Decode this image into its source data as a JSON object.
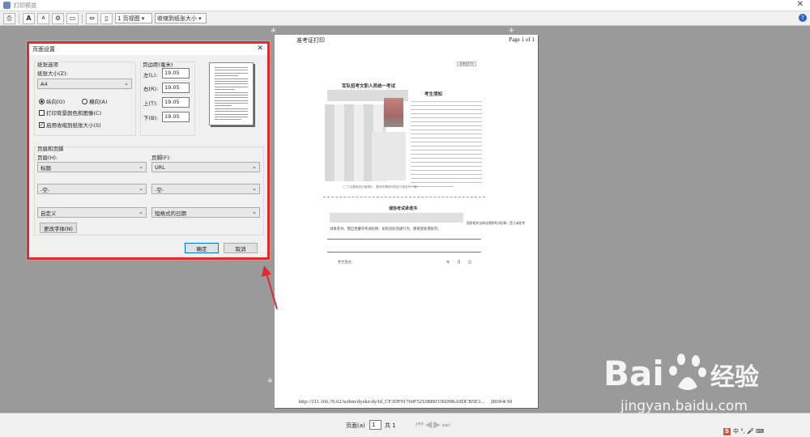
{
  "window": {
    "title": "打印预览"
  },
  "toolbar": {
    "view_select": "1 页视图",
    "shrink_select": "收缩到纸张大小",
    "text_size_a_large": "A",
    "text_size_a_small": "A"
  },
  "page_preview": {
    "header_left": "准考证打印",
    "header_right": "Page 1 of 1",
    "footer_url": "http://211.166.76.62/wzbm/dyzkz/dy/id_CF3DF91760F5210BB0336D9BA9DCB5E3...",
    "footer_date": "2019/4/10",
    "doc_title_left": "军队招考文职人员统一考试",
    "doc_title_right": "考生须知",
    "small_button": "准考证打印",
    "doc_subtitle": "诚信考试承诺书",
    "doc_line1": "试承诺书。我自觉遵守考试纪律，如有违纪违规行为，愿接受处理处罚。",
    "doc_line_right": "国家相关法律法规和考试纪律，签订诚信考",
    "photo_caption": "（二寸近期免冠正面照片，要求须清晰可辨且与报名时一致）",
    "signature_label": "考生签名：",
    "signature_icons": "年 月 日"
  },
  "dialog": {
    "title": "页面设置",
    "paper_group": "纸张选项",
    "paper_size_label": "纸张大小(Z):",
    "paper_size_value": "A4",
    "portrait_label": "纵向(O)",
    "landscape_label": "横向(A)",
    "print_bg_label": "打印背景颜色和图像(C)",
    "shrink_label": "启用收缩到纸张大小(S)",
    "margins_group": "页边距(毫米)",
    "left_label": "左(L):",
    "right_label": "右(R):",
    "top_label": "上(T):",
    "bottom_label": "下(B):",
    "left_value": "19.05",
    "right_value": "19.05",
    "top_value": "19.05",
    "bottom_value": "19.05",
    "hf_group": "页眉和页脚",
    "header_label": "页眉(H):",
    "footer_label": "页脚(F):",
    "header_1": "标题",
    "footer_1": "URL",
    "header_2": "-空-",
    "footer_2": "-空-",
    "header_3": "自定义",
    "footer_3": "短格式的日期",
    "change_font": "更改字体(N)",
    "ok": "确定",
    "cancel": "取消"
  },
  "statusbar": {
    "page_label": "页面(a)",
    "page_value": "1",
    "total_label": "共 1",
    "tray_text": "中 °, 🎤 ⌨"
  },
  "watermark": {
    "brand": "Bai",
    "brand_cn": "经验",
    "url": "jingyan.baidu.com"
  },
  "colors": {
    "highlight": "#e02b2b",
    "background": "#9a9a9a"
  }
}
